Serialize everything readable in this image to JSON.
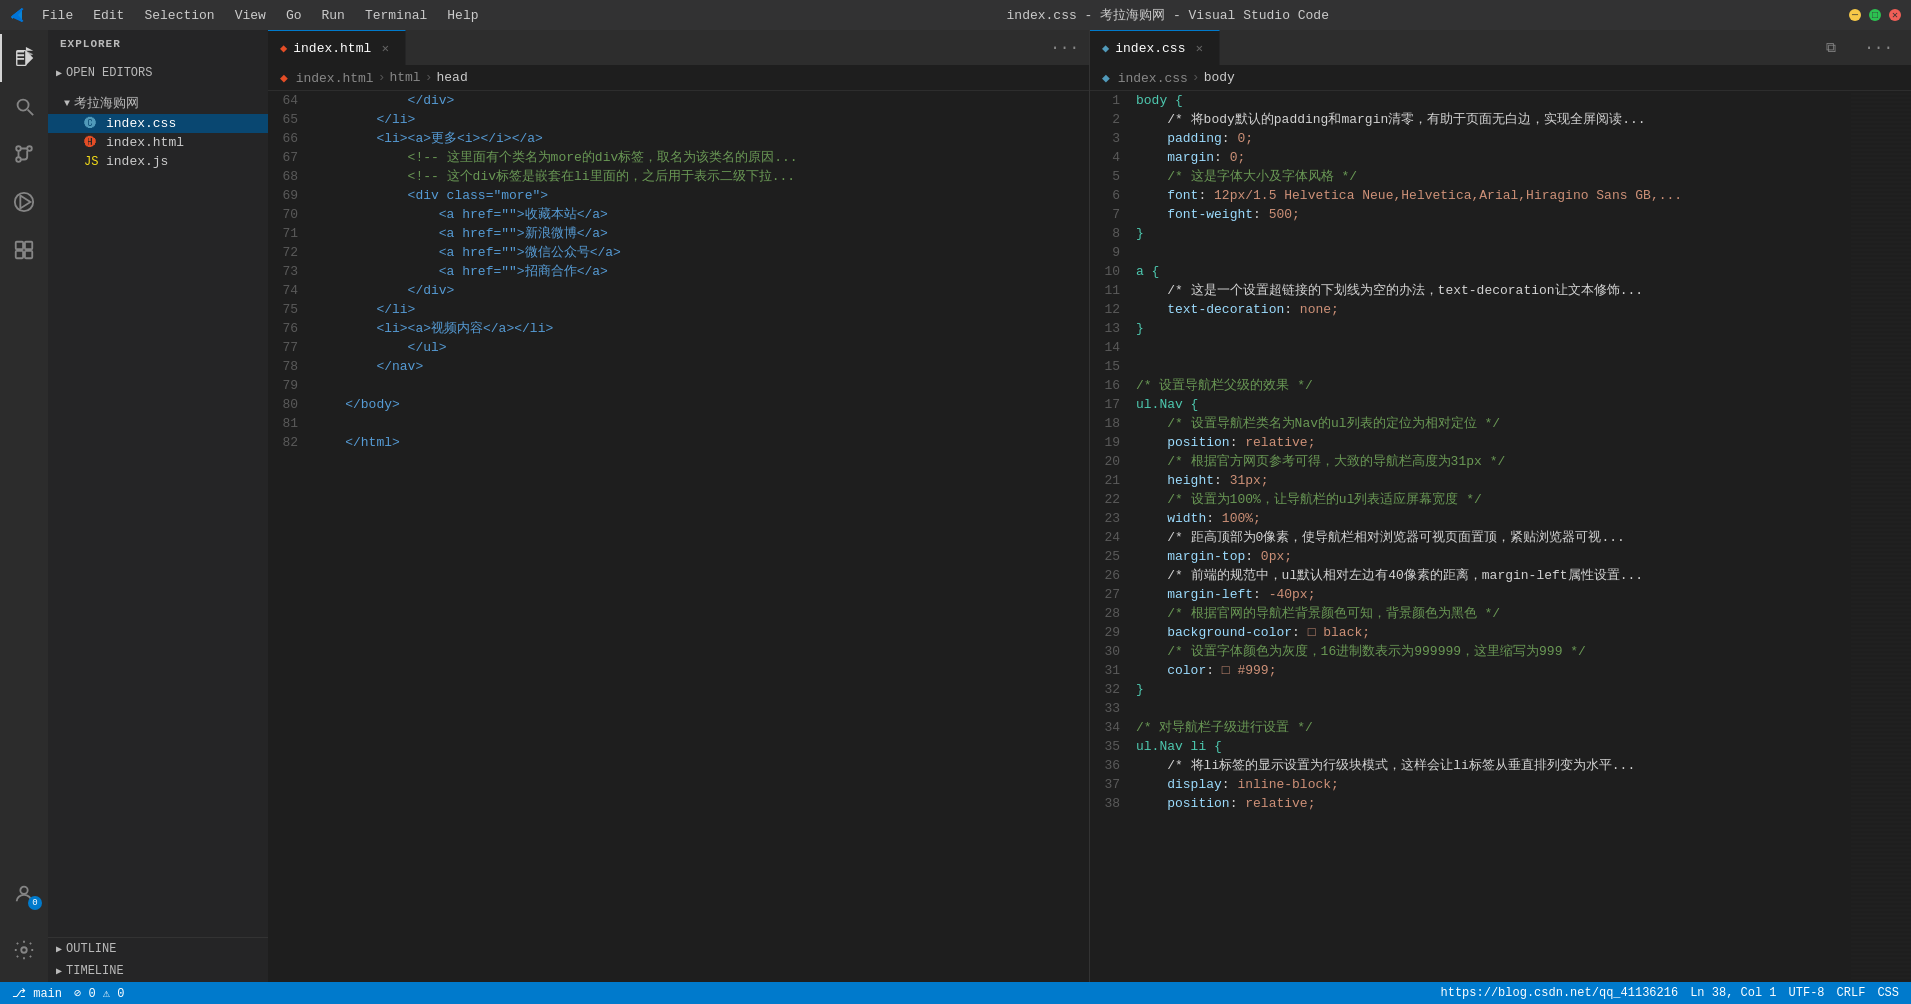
{
  "titlebar": {
    "title": "index.css - 考拉海购网 - Visual Studio Code",
    "menu_items": [
      "File",
      "Edit",
      "Selection",
      "View",
      "Go",
      "Run",
      "Terminal",
      "Help"
    ]
  },
  "sidebar": {
    "header": "EXPLORER",
    "open_editors_label": "OPEN EDITORS",
    "project_name": "考拉海购网",
    "files": [
      {
        "name": "index.css",
        "type": "css",
        "active": true
      },
      {
        "name": "index.html",
        "type": "html",
        "active": false
      },
      {
        "name": "index.js",
        "type": "js",
        "active": false
      }
    ],
    "outline_label": "OUTLINE",
    "timeline_label": "TIMELINE"
  },
  "left_editor": {
    "tab_label": "index.html",
    "breadcrumb": [
      "index.html",
      "html",
      "head"
    ],
    "lines": [
      {
        "num": 64,
        "content": "            </div>"
      },
      {
        "num": 65,
        "content": "        </li>"
      },
      {
        "num": 66,
        "content": "        <li><a>更多<i></i></a>"
      },
      {
        "num": 67,
        "content": "            <!-- 这里面有个类名为more的div标签，取名为该类名的原因..."
      },
      {
        "num": 68,
        "content": "            <!-- 这个div标签是嵌套在li里面的，之后用于表示二级下拉..."
      },
      {
        "num": 69,
        "content": "            <div class=\"more\">"
      },
      {
        "num": 70,
        "content": "                <a href=\"\">收藏本站</a>"
      },
      {
        "num": 71,
        "content": "                <a href=\"\">新浪微博</a>"
      },
      {
        "num": 72,
        "content": "                <a href=\"\">微信公众号</a>"
      },
      {
        "num": 73,
        "content": "                <a href=\"\">招商合作</a>"
      },
      {
        "num": 74,
        "content": "            </div>"
      },
      {
        "num": 75,
        "content": "        </li>"
      },
      {
        "num": 76,
        "content": "        <li><a>视频内容</a></li>"
      },
      {
        "num": 77,
        "content": "            </ul>"
      },
      {
        "num": 78,
        "content": "        </nav>"
      },
      {
        "num": 79,
        "content": ""
      },
      {
        "num": 80,
        "content": "    </body>"
      },
      {
        "num": 81,
        "content": ""
      },
      {
        "num": 82,
        "content": "    </html>"
      }
    ]
  },
  "right_editor": {
    "tab_label": "index.css",
    "breadcrumb": [
      "index.css",
      "body"
    ],
    "lines": [
      {
        "num": 1,
        "content": "body {"
      },
      {
        "num": 2,
        "content": "    /* 将body默认的padding和margin清零，有助于页面无白边，实现全屏阅读..."
      },
      {
        "num": 3,
        "content": "    padding: 0;"
      },
      {
        "num": 4,
        "content": "    margin: 0;"
      },
      {
        "num": 5,
        "content": "    /* 这是字体大小及字体风格 */"
      },
      {
        "num": 6,
        "content": "    font: 12px/1.5 Helvetica Neue,Helvetica,Arial,Hiragino Sans GB,..."
      },
      {
        "num": 7,
        "content": "    font-weight: 500;"
      },
      {
        "num": 8,
        "content": "}"
      },
      {
        "num": 9,
        "content": ""
      },
      {
        "num": 10,
        "content": "a {"
      },
      {
        "num": 11,
        "content": "    /* 这是一个设置超链接的下划线为空的办法，text-decoration让文本修饰..."
      },
      {
        "num": 12,
        "content": "    text-decoration: none;"
      },
      {
        "num": 13,
        "content": "}"
      },
      {
        "num": 14,
        "content": ""
      },
      {
        "num": 15,
        "content": ""
      },
      {
        "num": 16,
        "content": "/* 设置导航栏父级的效果 */"
      },
      {
        "num": 17,
        "content": "ul.Nav {"
      },
      {
        "num": 18,
        "content": "    /* 设置导航栏类名为Nav的ul列表的定位为相对定位 */"
      },
      {
        "num": 19,
        "content": "    position: relative;"
      },
      {
        "num": 20,
        "content": "    /* 根据官方网页参考可得，大致的导航栏高度为31px */"
      },
      {
        "num": 21,
        "content": "    height: 31px;"
      },
      {
        "num": 22,
        "content": "    /* 设置为100%，让导航栏的ul列表适应屏幕宽度 */"
      },
      {
        "num": 23,
        "content": "    width: 100%;"
      },
      {
        "num": 24,
        "content": "    /* 距高顶部为0像素，使导航栏相对浏览器可视页面置顶，紧贴浏览器可视..."
      },
      {
        "num": 25,
        "content": "    margin-top: 0px;"
      },
      {
        "num": 26,
        "content": "    /* 前端的规范中，ul默认相对左边有40像素的距离，margin-left属性设置..."
      },
      {
        "num": 27,
        "content": "    margin-left: -40px;"
      },
      {
        "num": 28,
        "content": "    /* 根据官网的导航栏背景颜色可知，背景颜色为黑色 */"
      },
      {
        "num": 29,
        "content": "    background-color: □ black;"
      },
      {
        "num": 30,
        "content": "    /* 设置字体颜色为灰度，16进制数表示为999999，这里缩写为999 */"
      },
      {
        "num": 31,
        "content": "    color: □ #999;"
      },
      {
        "num": 32,
        "content": "}"
      },
      {
        "num": 33,
        "content": ""
      },
      {
        "num": 34,
        "content": "/* 对导航栏子级进行设置 */"
      },
      {
        "num": 35,
        "content": "ul.Nav li {"
      },
      {
        "num": 36,
        "content": "    /* 将li标签的显示设置为行级块模式，这样会让li标签从垂直排列变为水平..."
      },
      {
        "num": 37,
        "content": "    display: inline-block;"
      },
      {
        "num": 38,
        "content": "    position: relative;"
      }
    ]
  },
  "status_bar": {
    "branch": "main",
    "errors": "0",
    "warnings": "0",
    "link": "https://blog.csdn.net/qq_41136216",
    "encoding": "UTF-8",
    "line_ending": "CRLF",
    "language": "CSS",
    "cursor": "Ln 38, Col 1"
  }
}
